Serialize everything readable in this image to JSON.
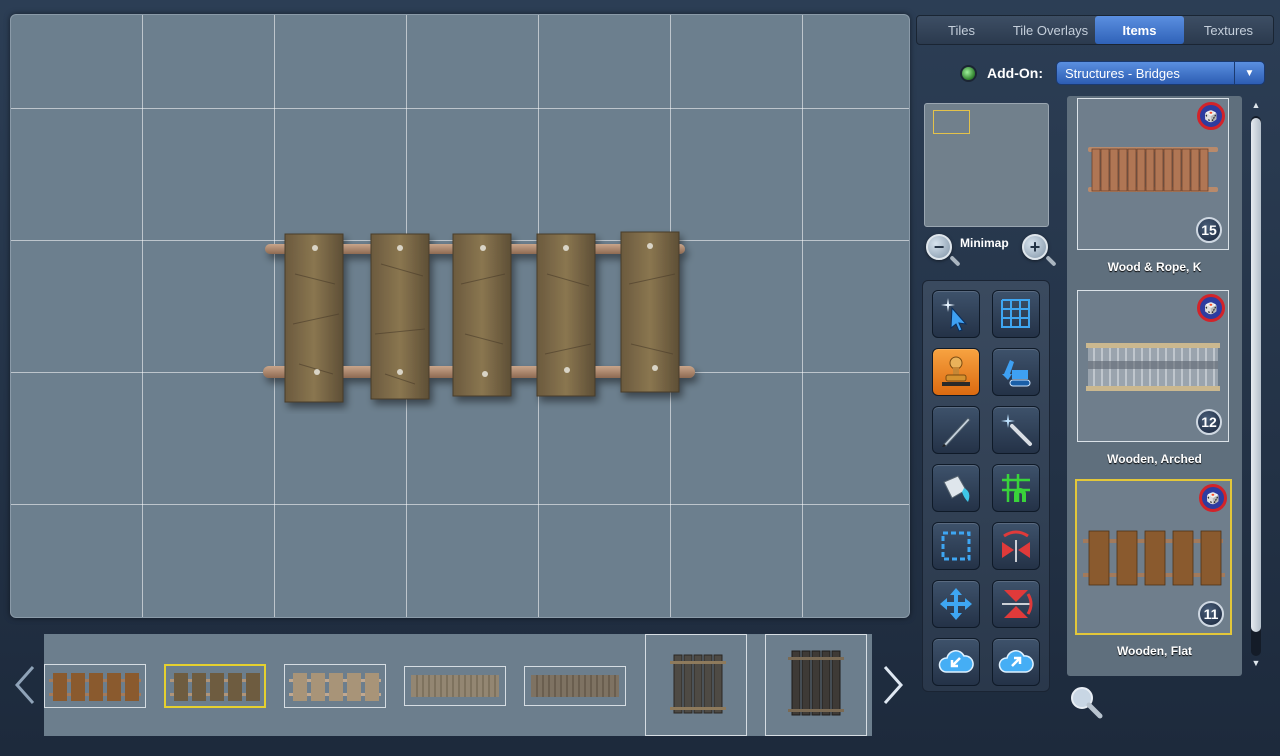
{
  "tabs": [
    {
      "label": "Tiles",
      "active": false
    },
    {
      "label": "Tile Overlays",
      "active": false
    },
    {
      "label": "Items",
      "active": true
    },
    {
      "label": "Textures",
      "active": false
    }
  ],
  "addon": {
    "label": "Add-On:",
    "selected": "Structures - Bridges"
  },
  "minimap": {
    "label": "Minimap",
    "zoom_out_symbol": "−",
    "zoom_in_symbol": "+"
  },
  "tools": [
    {
      "name": "select-tool",
      "icon": "sparkle-cursor-icon",
      "active": false
    },
    {
      "name": "grid-tool",
      "icon": "grid-icon",
      "active": false
    },
    {
      "name": "stamp-tool",
      "icon": "stamp-icon",
      "active": true
    },
    {
      "name": "erase-tool",
      "icon": "excavator-icon",
      "active": false
    },
    {
      "name": "draw-tool",
      "icon": "pencil-icon",
      "active": false
    },
    {
      "name": "magic-wand-tool",
      "icon": "magic-wand-icon",
      "active": false
    },
    {
      "name": "fill-tool",
      "icon": "paint-bucket-icon",
      "active": false
    },
    {
      "name": "snap-grid-tool",
      "icon": "snap-grid-icon",
      "active": false
    },
    {
      "name": "selection-rect-tool",
      "icon": "dashed-rect-icon",
      "active": false
    },
    {
      "name": "flip-horizontal-tool",
      "icon": "flip-horizontal-icon",
      "active": false
    },
    {
      "name": "move-tool",
      "icon": "move-arrows-icon",
      "active": false
    },
    {
      "name": "flip-vertical-tool",
      "icon": "flip-vertical-icon",
      "active": false
    },
    {
      "name": "import-tool",
      "icon": "cloud-import-icon",
      "active": false
    },
    {
      "name": "export-tool",
      "icon": "cloud-export-icon",
      "active": false
    }
  ],
  "items": [
    {
      "label": "Wood & Rope, K",
      "count": "15",
      "selected": false
    },
    {
      "label": "Wooden, Arched",
      "count": "12",
      "selected": false
    },
    {
      "label": "Wooden, Flat",
      "count": "11",
      "selected": true
    }
  ],
  "colors": {
    "canvas": "#6c7f8e",
    "accent": "#3a72cc",
    "active_tool": "#e8821f",
    "selection": "#e3c73a"
  }
}
